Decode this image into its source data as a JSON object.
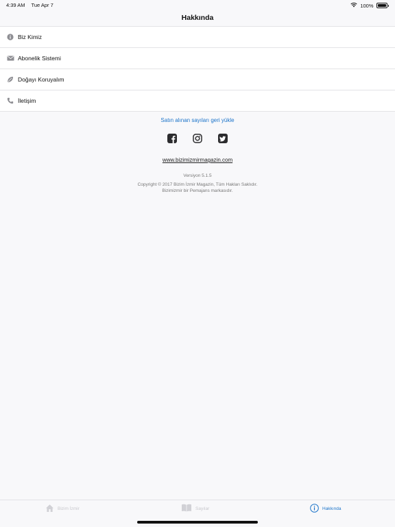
{
  "status_bar": {
    "time": "4:39 AM",
    "date": "Tue Apr 7",
    "battery": "100%"
  },
  "nav": {
    "title": "Hakkında"
  },
  "menu": {
    "items": [
      {
        "label": "Biz Kimiz",
        "icon": "info-icon"
      },
      {
        "label": "Abonelik Sistemi",
        "icon": "envelope-icon"
      },
      {
        "label": "Doğayı Koruyalım",
        "icon": "leaf-icon"
      },
      {
        "label": "İletişim",
        "icon": "phone-icon"
      }
    ]
  },
  "restore_link": "Satın alınan sayıları geri yükle",
  "social": [
    "facebook-icon",
    "instagram-icon",
    "twitter-icon"
  ],
  "website": "www.bizimizmirmagazin.com",
  "version": "Versiyon 5.1.5",
  "copyright_line1": "Copyright © 2017 Bizim İzmir Magazin, Tüm Hakları Saklıdır.",
  "copyright_line2": "Bizimizmir bir Pemajans markasıdır.",
  "tabs": {
    "items": [
      {
        "label": "Bizim İzmir",
        "icon": "home-icon",
        "active": false
      },
      {
        "label": "Sayılar",
        "icon": "book-icon",
        "active": false
      },
      {
        "label": "Hakkında",
        "icon": "info-circle-icon",
        "active": true
      }
    ]
  },
  "colors": {
    "accent": "#1a73c9",
    "background": "#f8f8fa",
    "inactive_tab": "#c7c7cc"
  }
}
